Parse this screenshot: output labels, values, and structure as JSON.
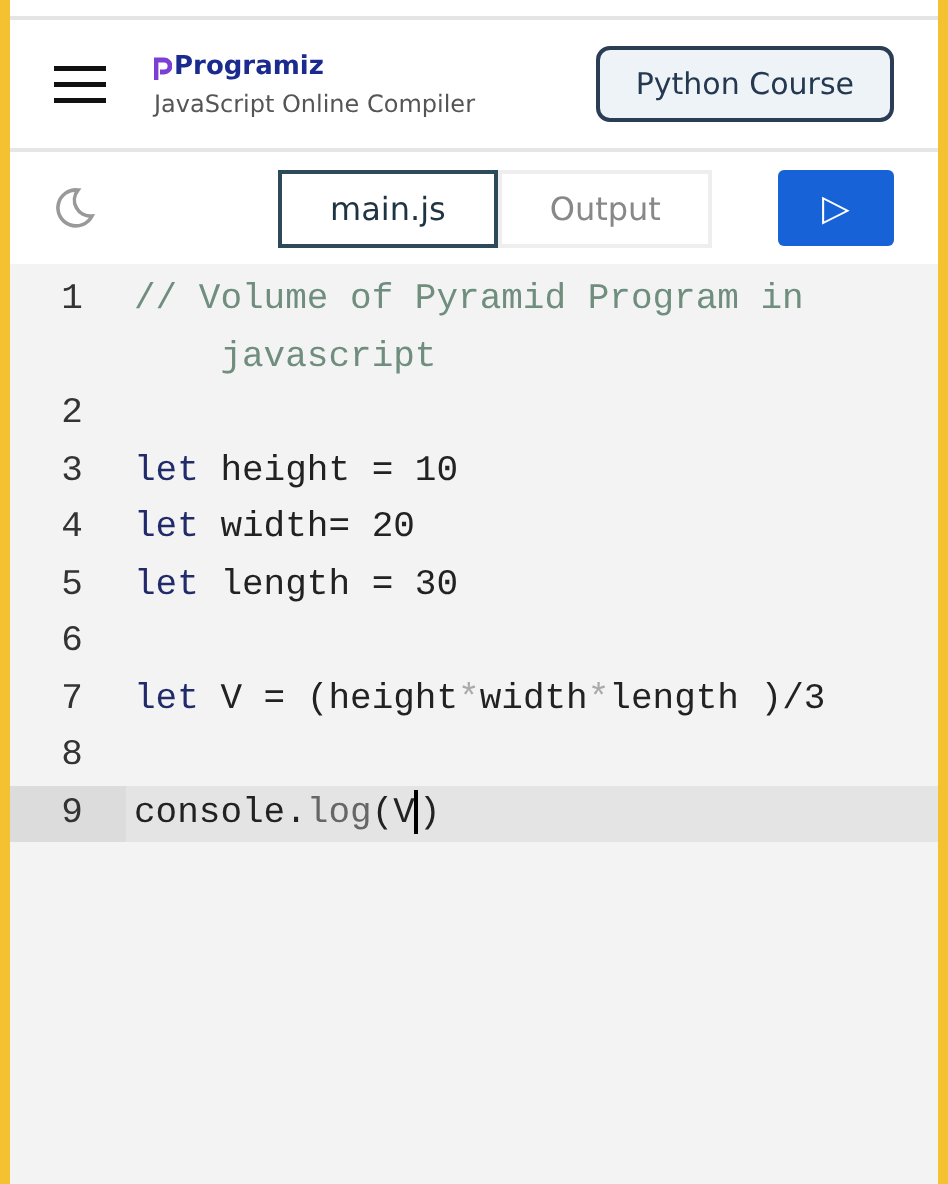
{
  "header": {
    "brand": "Programiz",
    "subtitle": "JavaScript Online Compiler",
    "course_button": "Python Course"
  },
  "tabs": [
    {
      "label": "main.js",
      "selected": true
    },
    {
      "label": "Output",
      "selected": false
    }
  ],
  "run_button": {
    "icon": "▷"
  },
  "editor": {
    "lines": [
      {
        "number": "1",
        "active": false,
        "tokens": [
          {
            "text": "// Volume of Pyramid Program in javascript",
            "kind": "comment"
          }
        ]
      },
      {
        "number": "2",
        "active": false
      },
      {
        "number": "3",
        "active": false,
        "tokens": [
          {
            "text": "let",
            "kind": "keyword"
          },
          {
            "text": " height = 10",
            "kind": "plain"
          }
        ]
      },
      {
        "number": "4",
        "active": false,
        "tokens": [
          {
            "text": "let",
            "kind": "keyword"
          },
          {
            "text": " width= 20",
            "kind": "plain"
          }
        ]
      },
      {
        "number": "5",
        "active": false,
        "tokens": [
          {
            "text": "let",
            "kind": "keyword"
          },
          {
            "text": " length = 30",
            "kind": "plain"
          }
        ]
      },
      {
        "number": "6",
        "active": false
      },
      {
        "number": "7",
        "active": false,
        "tokens": [
          {
            "text": "let",
            "kind": "keyword"
          },
          {
            "text": " V = (height",
            "kind": "plain"
          },
          {
            "text": "*",
            "kind": "operator"
          },
          {
            "text": "width",
            "kind": "plain"
          },
          {
            "text": "*",
            "kind": "operator"
          },
          {
            "text": "length )/3",
            "kind": "plain"
          }
        ]
      },
      {
        "number": "8",
        "active": false
      },
      {
        "number": "9",
        "active": true,
        "tokens": [
          {
            "text": "console.",
            "kind": "plain"
          },
          {
            "text": "log",
            "kind": "method"
          },
          {
            "text": "(V",
            "kind": "plain",
            "cursor": true
          },
          {
            "text": ")",
            "kind": "plain"
          }
        ]
      }
    ]
  }
}
